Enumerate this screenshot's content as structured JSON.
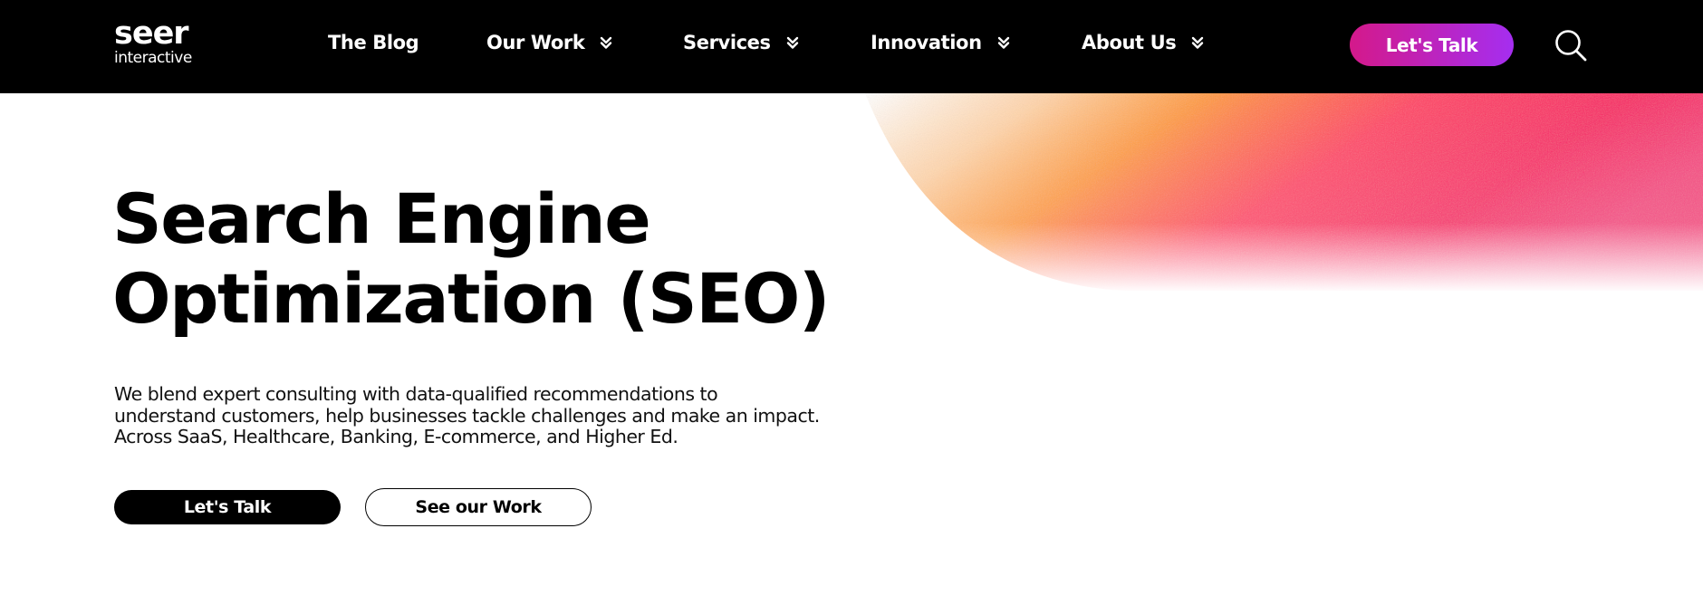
{
  "header": {
    "logo": {
      "brand": "seer",
      "tagline": "interactive"
    },
    "nav": [
      {
        "label": "The Blog",
        "has_dropdown": false
      },
      {
        "label": "Our Work",
        "has_dropdown": true
      },
      {
        "label": "Services",
        "has_dropdown": true
      },
      {
        "label": "Innovation",
        "has_dropdown": true
      },
      {
        "label": "About Us",
        "has_dropdown": true
      }
    ],
    "cta_label": "Let's Talk",
    "search_icon": "search-icon"
  },
  "hero": {
    "title_line1": "Search Engine",
    "title_line2": "Optimization (SEO)",
    "description": "We blend expert consulting with data-qualified recommendations to understand customers, help businesses tackle challenges and make an impact. Across SaaS, Healthcare, Banking, E-commerce, and Higher Ed.",
    "primary_button": "Let's Talk",
    "secondary_button": "See our Work"
  },
  "colors": {
    "nav_background": "#000000",
    "cta_gradient_start": "#d4198a",
    "cta_gradient_end": "#a52ef0",
    "blob_orange": "#ff9a3c",
    "blob_pink": "#ff1f6a"
  }
}
